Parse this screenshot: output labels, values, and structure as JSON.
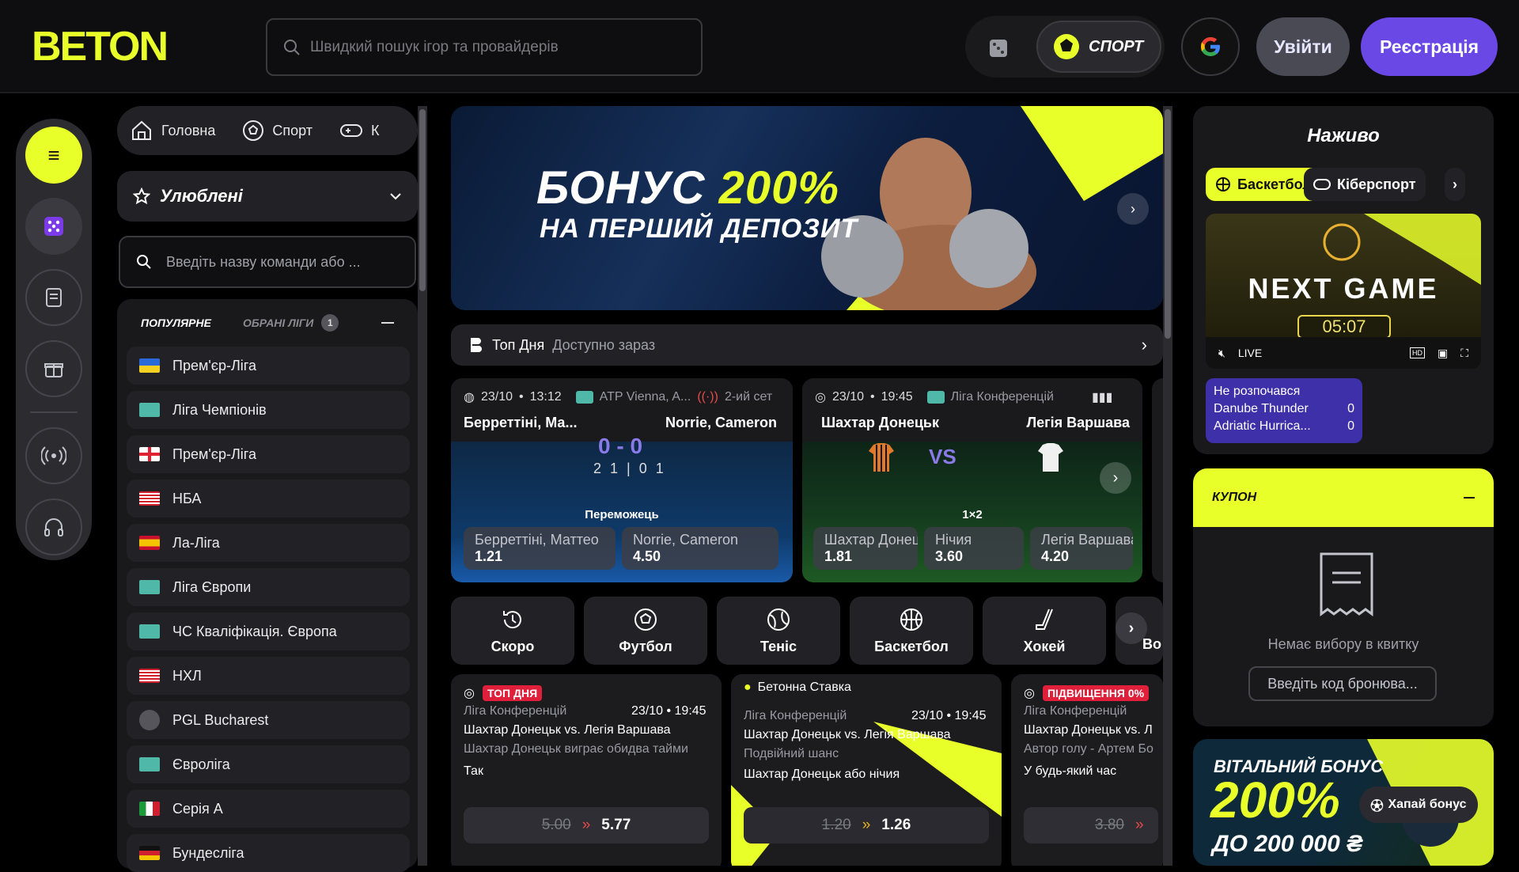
{
  "header": {
    "logo_text": "BETON",
    "search_placeholder": "Швидкий пошук ігор та провайдерів",
    "sport_label": "СПОРТ",
    "login_label": "Увійти",
    "register_label": "Реєстрація"
  },
  "nav": {
    "items": [
      {
        "label": "Головна",
        "icon": "home-icon"
      },
      {
        "label": "Спорт",
        "icon": "soccer-ball-icon"
      },
      {
        "label": "К",
        "icon": "gamepad-icon"
      }
    ]
  },
  "favorites": {
    "label": "Улюблені"
  },
  "team_search": {
    "placeholder": "Введіть назву команди або ..."
  },
  "league_tabs": {
    "popular": "ПОПУЛЯРНЕ",
    "chosen": "ОБРАНІ ЛІГИ",
    "chosen_count": "1"
  },
  "leagues": [
    {
      "label": "Прем'єр-Ліга",
      "flag": "ukraine"
    },
    {
      "label": "Ліга Чемпіонів",
      "flag": "europe"
    },
    {
      "label": "Прем'єр-Ліга",
      "flag": "england"
    },
    {
      "label": "НБА",
      "flag": "usa"
    },
    {
      "label": "Ла-Ліга",
      "flag": "spain"
    },
    {
      "label": "Ліга Європи",
      "flag": "europe"
    },
    {
      "label": "ЧС Кваліфікація. Європа",
      "flag": "europe"
    },
    {
      "label": "НХЛ",
      "flag": "usa"
    },
    {
      "label": "PGL Bucharest",
      "flag": "esports"
    },
    {
      "label": "Євроліга",
      "flag": "europe"
    },
    {
      "label": "Серія А",
      "flag": "italy"
    },
    {
      "label": "Бундесліга",
      "flag": "germany"
    }
  ],
  "banner": {
    "title_a": "БОНУС ",
    "title_b": "200%",
    "subtitle": "НА ПЕРШИЙ ДЕПОЗИТ"
  },
  "top_day": {
    "title": "Топ Дня",
    "status": "Доступно зараз"
  },
  "matches": [
    {
      "date": "23/10",
      "time": "13:12",
      "league": "ATP Vienna, A...",
      "live_status": "2-ий сет",
      "home": "Берреттіні, Ма...",
      "away": "Norrie, Cameron",
      "score": "0 - 0",
      "sets": "2 1 | 0 1",
      "market": "Переможець",
      "odds": [
        {
          "label": "Берреттіні, Маттео",
          "value": "1.21"
        },
        {
          "label": "Norrie, Cameron",
          "value": "4.50"
        }
      ]
    },
    {
      "date": "23/10",
      "time": "19:45",
      "league": "Ліга Конференцій",
      "home": "Шахтар Донецьк",
      "away": "Легія Варшава",
      "vs": "VS",
      "market": "1×2",
      "odds": [
        {
          "label": "Шахтар Донецьк",
          "value": "1.81"
        },
        {
          "label": "Нічия",
          "value": "3.60"
        },
        {
          "label": "Легія Варшава",
          "value": "4.20"
        }
      ]
    }
  ],
  "categories": [
    "Скоро",
    "Футбол",
    "Теніс",
    "Баскетбол",
    "Хокей",
    "Во"
  ],
  "bets": [
    {
      "badge": "ТОП ДНЯ",
      "league": "Ліга Конференцій",
      "datetime": "23/10 • 19:45",
      "match": "Шахтар Донецьк vs. Легія Варшава",
      "market": "Шахтар Донецьк виграє обидва тайми",
      "pick": "Так",
      "old": "5.00",
      "new": "5.77"
    },
    {
      "badge": "Бетонна Ставка",
      "league": "Ліга Конференцій",
      "datetime": "23/10 • 19:45",
      "match": "Шахтар Донецьк vs. Легія Варшава",
      "market": "Подвійний шанс",
      "pick": "Шахтар Донецьк або нічия",
      "old": "1.20",
      "new": "1.26"
    },
    {
      "badge": "ПІДВИЩЕННЯ 0%",
      "league": "Ліга Конференцій",
      "match": "Шахтар Донецьк vs. Л",
      "market": "Автор голу - Артем Бо",
      "pick": "У будь-який час",
      "old": "3.80"
    }
  ],
  "live": {
    "title": "Наживо",
    "tabs": [
      "Баскетбол",
      "Кіберспорт"
    ],
    "video_title": "NEXT GAME",
    "timer": "05:07",
    "live_label": "LIVE",
    "not_started": "Не розпочався",
    "teams": [
      {
        "name": "Danube Thunder",
        "score": "0"
      },
      {
        "name": "Adriatic Hurrica...",
        "score": "0"
      }
    ]
  },
  "coupon": {
    "title": "КУПОН",
    "empty": "Немає вибору в квитку",
    "code_placeholder": "Введіть код бронюва..."
  },
  "promo": {
    "a": "ВІТАЛЬНИЙ БОНУС",
    "b": "200%",
    "c": "ДО 200 000 ₴",
    "btn": "Хапай бонус"
  },
  "colors": {
    "accent": "#e8ff2a",
    "primary": "#6a48e6",
    "bg": "#0e0e10"
  }
}
